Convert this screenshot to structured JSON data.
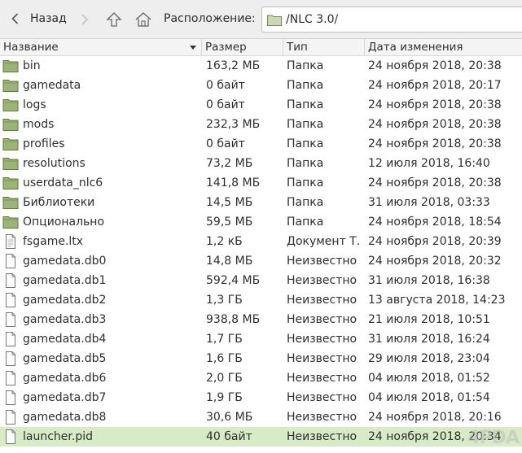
{
  "toolbar": {
    "back_label": "Назад",
    "location_label": "Расположение:",
    "location_path": "/NLC 3.0/"
  },
  "columns": {
    "name": "Название",
    "size": "Размер",
    "type": "Тип",
    "date": "Дата изменения"
  },
  "files": [
    {
      "name": "bin",
      "size": "163,2 МБ",
      "type": "Папка",
      "date": "24 ноября 2018, 20:38",
      "icon": "folder-icon"
    },
    {
      "name": "gamedata",
      "size": "0 байт",
      "type": "Папка",
      "date": "24 ноября 2018, 20:17",
      "icon": "folder-icon"
    },
    {
      "name": "logs",
      "size": "0 байт",
      "type": "Папка",
      "date": "24 ноября 2018, 20:38",
      "icon": "folder-icon"
    },
    {
      "name": "mods",
      "size": "232,3 МБ",
      "type": "Папка",
      "date": "24 ноября 2018, 20:38",
      "icon": "folder-icon"
    },
    {
      "name": "profiles",
      "size": "0 байт",
      "type": "Папка",
      "date": "24 ноября 2018, 20:38",
      "icon": "folder-icon"
    },
    {
      "name": "resolutions",
      "size": "73,2 МБ",
      "type": "Папка",
      "date": "12 июля 2018, 16:40",
      "icon": "folder-icon"
    },
    {
      "name": "userdata_nlc6",
      "size": "141,8 МБ",
      "type": "Папка",
      "date": "24 ноября 2018, 20:38",
      "icon": "folder-icon"
    },
    {
      "name": "Библиотеки",
      "size": "14,5 МБ",
      "type": "Папка",
      "date": "31 июля 2018, 03:33",
      "icon": "folder-icon"
    },
    {
      "name": "Опционально",
      "size": "59,5 МБ",
      "type": "Папка",
      "date": "24 ноября 2018, 18:54",
      "icon": "folder-icon"
    },
    {
      "name": "fsgame.ltx",
      "size": "1,2 кБ",
      "type": "Документ Т…",
      "date": "24 ноября 2018, 20:39",
      "icon": "text-file-icon"
    },
    {
      "name": "gamedata.db0",
      "size": "14,8 МБ",
      "type": "Неизвестно",
      "date": "24 ноября 2018, 20:32",
      "icon": "file-icon"
    },
    {
      "name": "gamedata.db1",
      "size": "592,4 МБ",
      "type": "Неизвестно",
      "date": "31 июля 2018, 16:38",
      "icon": "file-icon"
    },
    {
      "name": "gamedata.db2",
      "size": "1,3 ГБ",
      "type": "Неизвестно",
      "date": "13 августа 2018, 14:23",
      "icon": "file-icon"
    },
    {
      "name": "gamedata.db3",
      "size": "938,8 МБ",
      "type": "Неизвестно",
      "date": "21 июля 2018, 10:51",
      "icon": "file-icon"
    },
    {
      "name": "gamedata.db4",
      "size": "1,7 ГБ",
      "type": "Неизвестно",
      "date": "31 июля 2018, 16:24",
      "icon": "file-icon"
    },
    {
      "name": "gamedata.db5",
      "size": "1,6 ГБ",
      "type": "Неизвестно",
      "date": "29 июля 2018, 23:04",
      "icon": "file-icon"
    },
    {
      "name": "gamedata.db6",
      "size": "2,0 ГБ",
      "type": "Неизвестно",
      "date": "04 июля 2018, 01:52",
      "icon": "file-icon"
    },
    {
      "name": "gamedata.db7",
      "size": "1,9 ГБ",
      "type": "Неизвестно",
      "date": "04 июля 2018, 01:54",
      "icon": "file-icon"
    },
    {
      "name": "gamedata.db8",
      "size": "30,6 МБ",
      "type": "Неизвестно",
      "date": "24 ноября 2018, 20:16",
      "icon": "file-icon"
    },
    {
      "name": "launcher.pid",
      "size": "40 байт",
      "type": "Неизвестно",
      "date": "24 ноября 2018, 20:34",
      "icon": "file-icon",
      "selected": true
    }
  ],
  "colors": {
    "selection": "#d7ecc6",
    "folder": "#8aa66a",
    "toolbar_bg": "#eeeeee"
  },
  "watermark": "4PDA"
}
